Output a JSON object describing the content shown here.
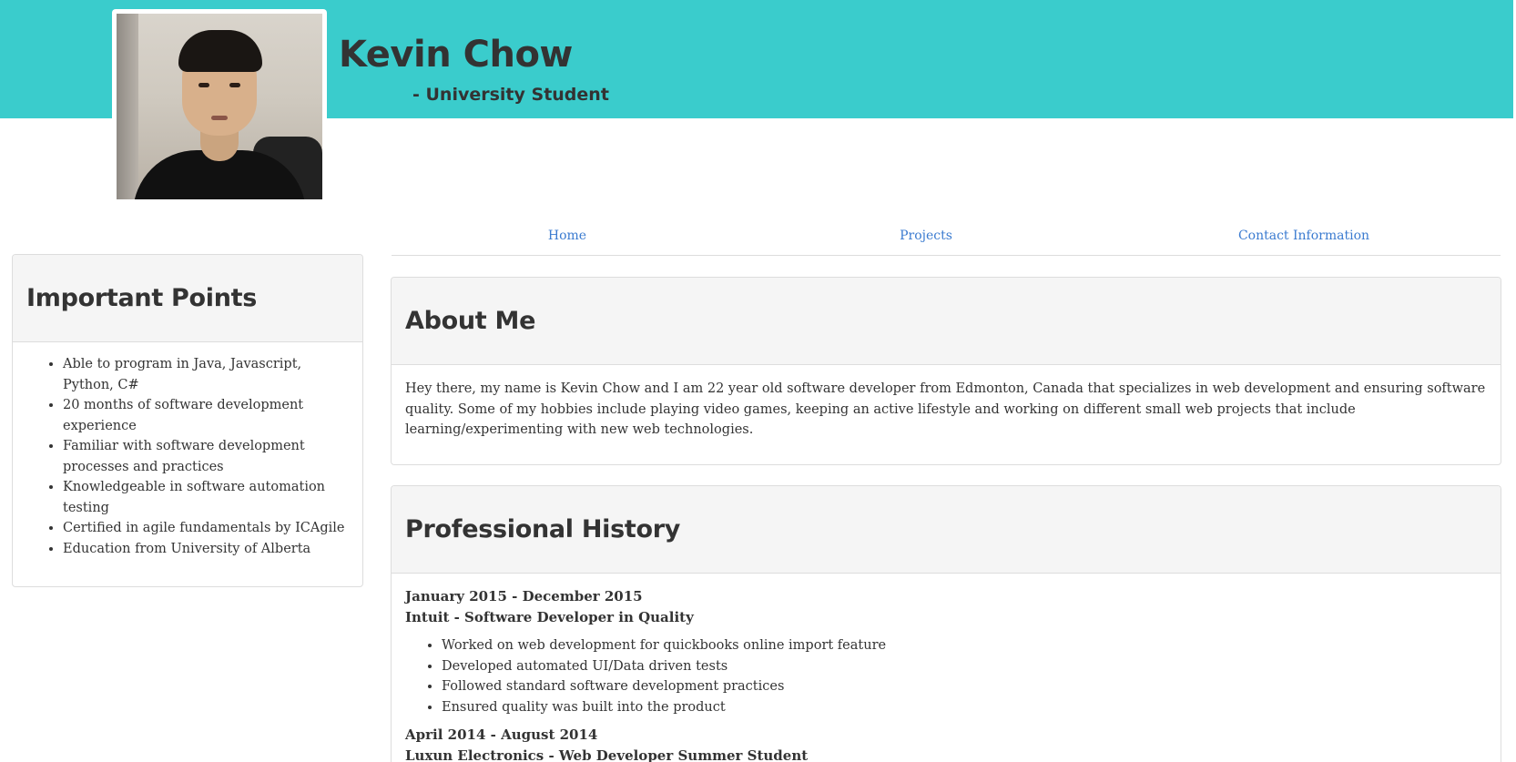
{
  "header": {
    "name": "Kevin Chow",
    "subtitle": "- University Student",
    "accent_color": "#3acccc"
  },
  "nav": {
    "items": [
      {
        "label": "Home"
      },
      {
        "label": "Projects"
      },
      {
        "label": "Contact Information"
      }
    ],
    "link_color": "#3b7bd0"
  },
  "sidebar": {
    "title": "Important Points",
    "items": [
      {
        "text": "Able to program in Java, Javascript, Python, C#"
      },
      {
        "text": "20 months of software development experience"
      },
      {
        "text": "Familiar with software development processes and practices"
      },
      {
        "text": "Knowledgeable in software automation testing"
      },
      {
        "text": "Certified in agile fundamentals by ICAgile"
      },
      {
        "text": "Education from University of Alberta"
      }
    ]
  },
  "about": {
    "title": "About Me",
    "body": "Hey there, my name is Kevin Chow and I am 22 year old software developer from Edmonton, Canada that specializes in web development and ensuring software quality. Some of my hobbies include playing video games, keeping an active lifestyle and working on different small web projects that include learning/experimenting with new web technologies."
  },
  "history": {
    "title": "Professional History",
    "jobs": [
      {
        "dates": "January 2015 - December 2015",
        "title": "Intuit - Software Developer in Quality",
        "bullets": [
          {
            "text": "Worked on web development for quickbooks online import feature"
          },
          {
            "text": "Developed automated UI/Data driven tests"
          },
          {
            "text": "Followed standard software development practices"
          },
          {
            "text": "Ensured quality was built into the product"
          }
        ]
      },
      {
        "dates": "April 2014 - August 2014",
        "title": "Luxun Electronics - Web Developer Summer Student",
        "bullets": []
      }
    ]
  }
}
